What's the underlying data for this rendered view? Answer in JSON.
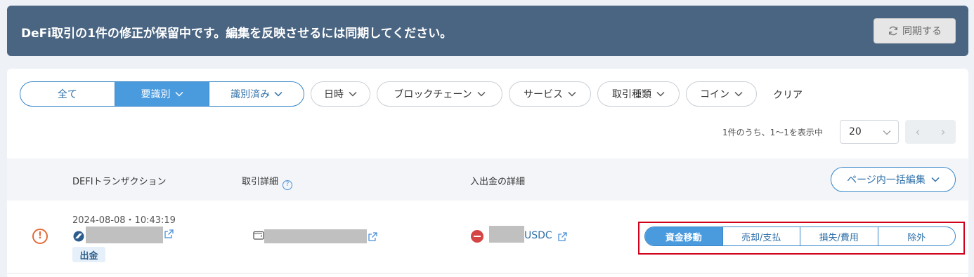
{
  "banner": {
    "message": "DeFi取引の1件の修正が保留中です。編集を反映させるには同期してください。",
    "sync_label": "同期する"
  },
  "filters": {
    "status_tabs": [
      {
        "label": "全て",
        "active": false
      },
      {
        "label": "要識別",
        "active": true
      },
      {
        "label": "識別済み",
        "active": false
      }
    ],
    "dropdowns": [
      "日時",
      "ブロックチェーン",
      "サービス",
      "取引種類",
      "コイン"
    ],
    "clear_label": "クリア"
  },
  "pagination": {
    "summary": "1件のうち、1〜1を表示中",
    "page_size": "20",
    "prev": "‹",
    "next": "›"
  },
  "table": {
    "columns": [
      "DEFIトランザクション",
      "取引詳細",
      "入出金の詳細"
    ],
    "bulk_edit_label": "ページ内一括編集",
    "rows": [
      {
        "datetime": "2024-08-08・10:43:19",
        "direction": "出金",
        "coin": "USDC",
        "categories": [
          "資金移動",
          "売却/支払",
          "損失/費用",
          "除外"
        ],
        "selected_category": "資金移動"
      }
    ]
  },
  "colors": {
    "banner_bg": "#4a6582",
    "accent": "#4a9ade",
    "warning": "#e46b3a",
    "outflow": "#d64545",
    "highlight": "#d0021b"
  }
}
